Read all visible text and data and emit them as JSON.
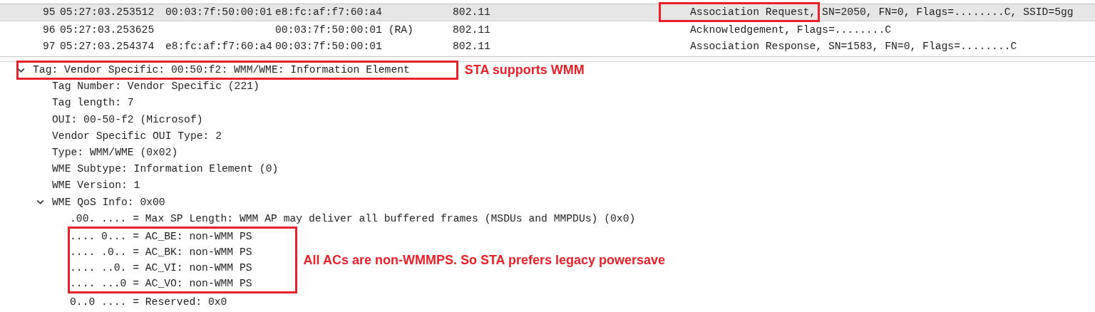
{
  "packet_list": {
    "rows": [
      {
        "no": "95",
        "time": "05:27:03.253512",
        "source": "00:03:7f:50:00:01",
        "destination": "e8:fc:af:f7:60:a4",
        "protocol": "802.11",
        "info": [
          {
            "text": "Association Request,",
            "highlighted": true
          },
          {
            "text": " SN=2050, FN=0, Flags=........C, SSID=5gg",
            "highlighted": false
          }
        ],
        "selected": true
      },
      {
        "no": "96",
        "time": "05:27:03.253625",
        "source": "",
        "destination": "00:03:7f:50:00:01 (RA)",
        "protocol": "802.11",
        "info": [
          {
            "text": "Acknowledgement, Flags=........C",
            "highlighted": false
          }
        ],
        "selected": false
      },
      {
        "no": "97",
        "time": "05:27:03.254374",
        "source": "e8:fc:af:f7:60:a4",
        "destination": "00:03:7f:50:00:01",
        "protocol": "802.11",
        "info": [
          {
            "text": "Association Response, SN=1583, FN=0, Flags=........C",
            "highlighted": false
          }
        ],
        "selected": false
      }
    ]
  },
  "packet_details": [
    {
      "kind": "node",
      "text": "Tag: Vendor Specific: 00:50:f2: WMM/WME: Information Element",
      "expanded": true,
      "highlighted": true,
      "annotation": "STA supports WMM",
      "children": [
        {
          "kind": "node",
          "text": "Tag Number: Vendor Specific (221)"
        },
        {
          "kind": "node",
          "text": "Tag length: 7"
        },
        {
          "kind": "node",
          "text": "OUI: 00-50-f2 (Microsof)"
        },
        {
          "kind": "node",
          "text": "Vendor Specific OUI Type: 2"
        },
        {
          "kind": "node",
          "text": "Type: WMM/WME (0x02)"
        },
        {
          "kind": "node",
          "text": "WME Subtype: Information Element (0)"
        },
        {
          "kind": "node",
          "text": "WME Version: 1"
        },
        {
          "kind": "node",
          "text": "WME QoS Info: 0x00",
          "expanded": true,
          "children": [
            {
              "kind": "node",
              "text": ".00. .... = Max SP Length: WMM AP may deliver all buffered frames (MSDUs and MMPDUs) (0x0)"
            },
            {
              "kind": "group",
              "highlighted": true,
              "annotation": "All ACs are non-WMMPS. So STA prefers legacy powersave",
              "children": [
                {
                  "kind": "node",
                  "text": ".... 0... = AC_BE: non-WMM PS"
                },
                {
                  "kind": "node",
                  "text": ".... .0.. = AC_BK: non-WMM PS"
                },
                {
                  "kind": "node",
                  "text": ".... ..0. = AC_VI: non-WMM PS"
                },
                {
                  "kind": "node",
                  "text": ".... ...0 = AC_VO: non-WMM PS"
                }
              ]
            },
            {
              "kind": "node",
              "text": "0..0 .... = Reserved: 0x0"
            }
          ]
        }
      ]
    }
  ]
}
